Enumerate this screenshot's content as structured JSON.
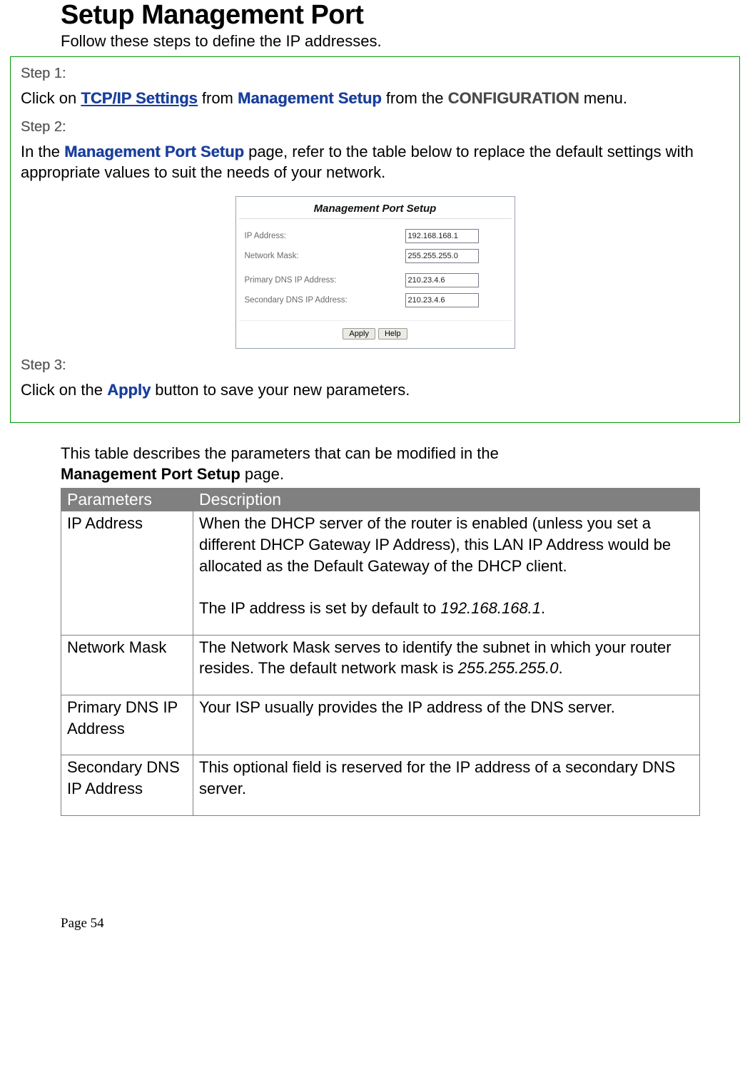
{
  "title": "Setup Management Port",
  "subtitle": "Follow these steps to define the IP addresses.",
  "steps": {
    "step1_label": "Step 1:",
    "step1_pre": "Click on ",
    "step1_a": "TCP/IP Settings",
    "step1_mid1": " from ",
    "step1_b": "Management Setup",
    "step1_mid2": " from the ",
    "step1_c": "CONFIGURATION",
    "step1_end": " menu.",
    "step2_label": "Step 2:",
    "step2_pre": "In the ",
    "step2_a": "Management Port Setup",
    "step2_end": " page, refer to the table below to replace the default settings with appropriate values to suit the needs of your network.",
    "step3_label": "Step 3:",
    "step3_pre": "Click on the ",
    "step3_a": "Apply",
    "step3_end": " button to save your new parameters."
  },
  "fig": {
    "title": "Management Port Setup",
    "row1_label": "IP Address:",
    "row1_value": "192.168.168.1",
    "row2_label": "Network Mask:",
    "row2_value": "255.255.255.0",
    "row3_label": "Primary DNS IP Address:",
    "row3_value": "210.23.4.6",
    "row4_label": "Secondary DNS IP Address:",
    "row4_value": "210.23.4.6",
    "btn_apply": "Apply",
    "btn_help": "Help"
  },
  "after": {
    "intro_pre": "This table describes the parameters that can be modified in the ",
    "intro_bold": "Management Port Setup",
    "intro_end": " page."
  },
  "table": {
    "h1": "Parameters",
    "h2": "Description",
    "r1c1": "IP Address",
    "r1c2a": "When the DHCP server of the router is enabled (unless you set a different DHCP Gateway IP Address), this LAN IP Address would be allocated as the Default Gateway of the DHCP client.",
    "r1c2b_pre": "The IP address is set by default to ",
    "r1c2b_i": "192.168.168.1",
    "r1c2b_end": ".",
    "r2c1": "Network Mask",
    "r2c2_pre": "The Network Mask serves to identify the subnet in which your router resides. The default network mask is ",
    "r2c2_i": "255.255.255.0",
    "r2c2_end": ".",
    "r3c1": "Primary DNS IP Address",
    "r3c2": "Your ISP usually provides the IP address of the DNS server.",
    "r4c1": "Secondary DNS IP Address",
    "r4c2": "This optional field is reserved for the IP address of a secondary DNS server."
  },
  "page_num": "Page 54"
}
